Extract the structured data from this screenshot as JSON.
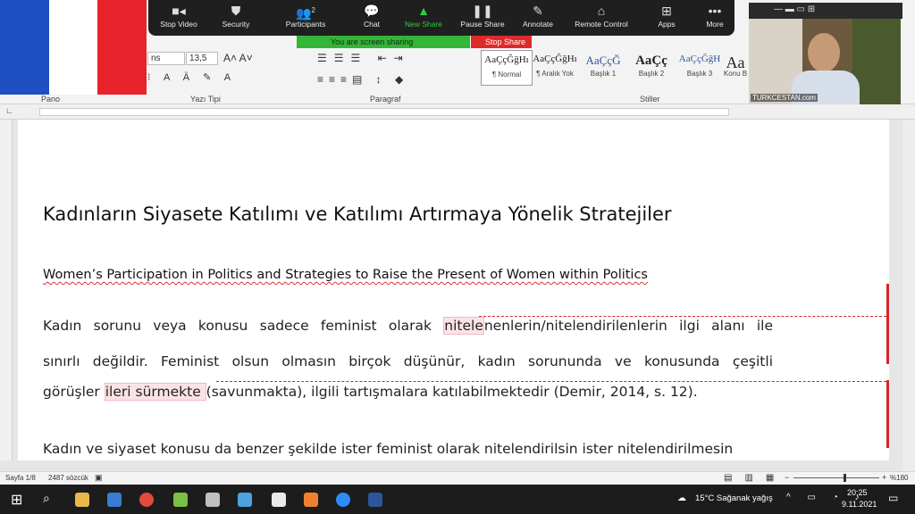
{
  "zoom_toolbar": {
    "items": [
      {
        "label": "Stop Video",
        "icon": "video-camera-icon"
      },
      {
        "label": "Security",
        "icon": "shield-icon"
      },
      {
        "label": "Participants",
        "icon": "participants-icon",
        "count": "2"
      },
      {
        "label": "Chat",
        "icon": "chat-icon"
      },
      {
        "label": "New Share",
        "icon": "share-screen-icon"
      },
      {
        "label": "Pause Share",
        "icon": "pause-icon"
      },
      {
        "label": "Annotate",
        "icon": "pencil-icon"
      },
      {
        "label": "Remote Control",
        "icon": "mouse-icon"
      },
      {
        "label": "Apps",
        "icon": "apps-icon"
      },
      {
        "label": "More",
        "icon": "more-icon"
      }
    ],
    "sharing_banner": "You are screen sharing",
    "stop_share": "Stop Share",
    "accent": "#34b538",
    "stop_color": "#e02a2a"
  },
  "ribbon": {
    "font_name": "ns",
    "font_size": "13,5",
    "groups": {
      "clipboard": "Pano",
      "font": "Yazı Tipi",
      "paragraph": "Paragraf",
      "styles": "Stiller"
    },
    "styles": [
      {
        "sample": "AaÇçĞğHı",
        "name": "¶ Normal"
      },
      {
        "sample": "AaÇçĞğHı",
        "name": "¶ Aralık Yok"
      },
      {
        "sample": "AaÇçĞ",
        "name": "Başlık 1"
      },
      {
        "sample": "AaÇç",
        "name": "Başlık 2"
      },
      {
        "sample": "AaÇçĞğH",
        "name": "Başlık 3"
      },
      {
        "sample": "Aa",
        "name": "Konu B"
      }
    ]
  },
  "document": {
    "title": "Kadınların Siyasete Katılımı ve Katılımı Artırmaya Yönelik Stratejiler",
    "subtitle": "Women’s Participation in Politics and Strategies to Raise the Present of Women within Politics",
    "para1_line1_a": "Kadın sorunu veya konusu sadece feminist olarak ",
    "para1_line1_mark": "nitele",
    "para1_line1_b": "nenlerin/nitelendirilenlerin ilgi alanı ile",
    "para1_line2": "sınırlı değildir. Feminist olsun olmasın birçok düşünür, kadın sorununda ve konusunda çeşitli",
    "para1_line3_a": "görüşler ",
    "para1_line3_mark": "ileri sürmekte ",
    "para1_line3_b": "(savunmakta), ilgili tartışmalara katılabilmektedir (Demir, 2014, s. 12).",
    "para2_line1": "Kadın ve siyaset konusu da benzer şekilde ister feminist olarak nitelendirilsin ister nitelendirilmesin"
  },
  "statusbar": {
    "page": "Sayfa 1/8",
    "words": "2487 sözcük",
    "zoom": "%180"
  },
  "video": {
    "watermark": "TURKCESTAN.com"
  },
  "taskbar": {
    "weather": "15°C  Sağanak yağış",
    "time": "20:25",
    "date": "9.11.2021"
  }
}
